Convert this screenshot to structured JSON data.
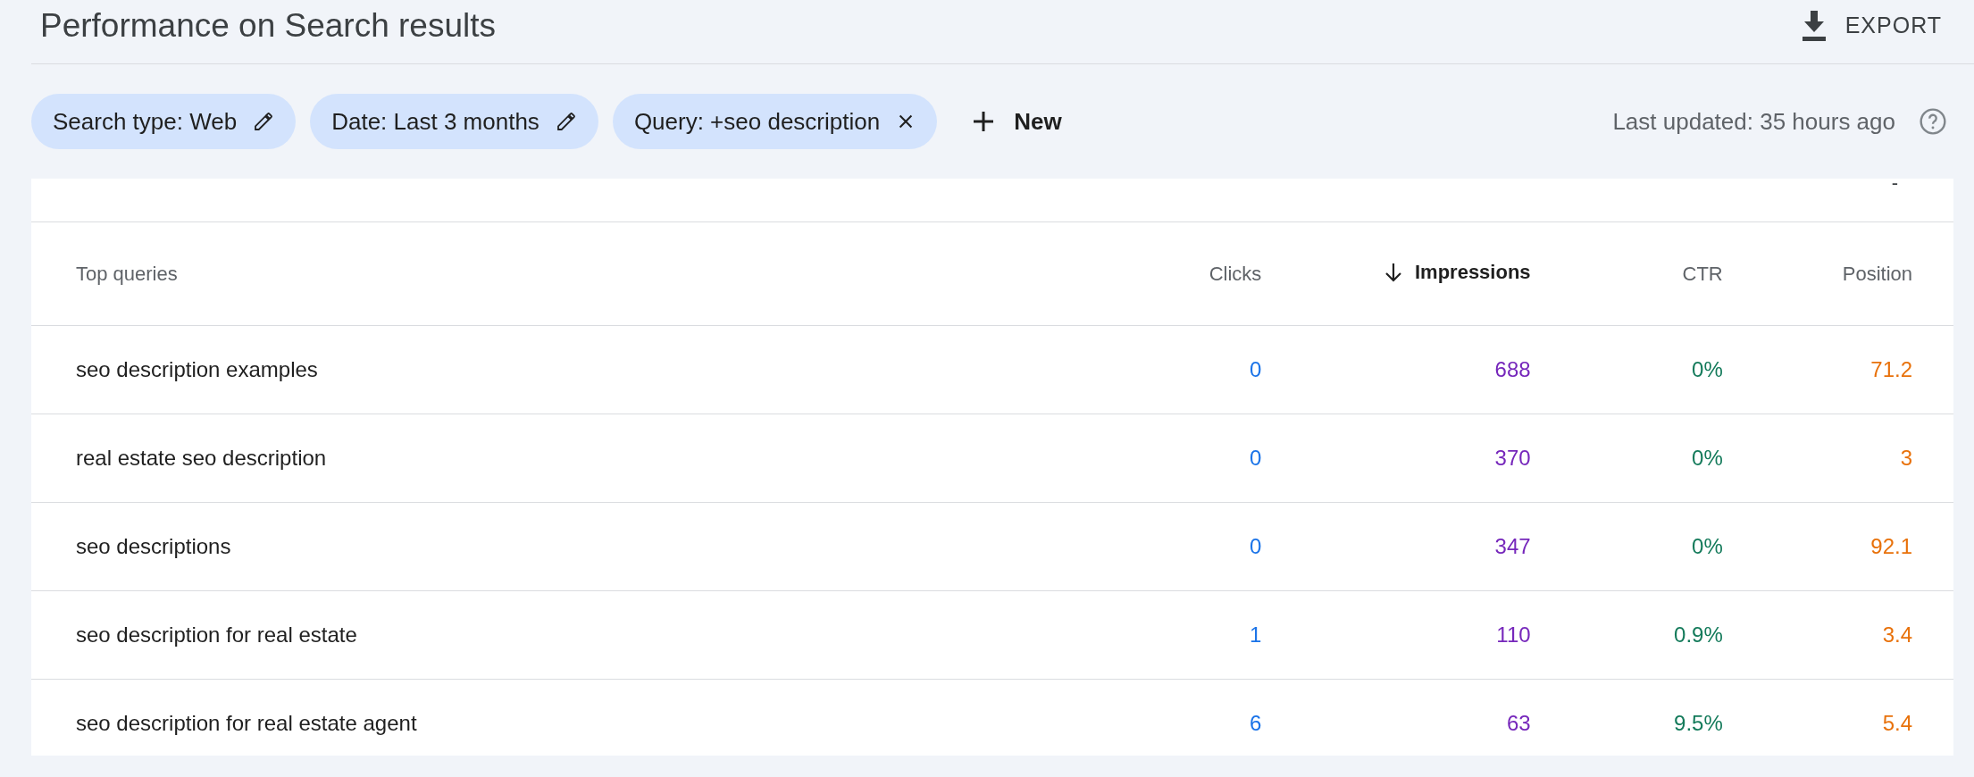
{
  "header": {
    "title": "Performance on Search results",
    "export_label": "EXPORT"
  },
  "filters": {
    "chips": [
      {
        "label": "Search type: Web",
        "kind": "edit"
      },
      {
        "label": "Date: Last 3 months",
        "kind": "edit"
      },
      {
        "label": "Query: +seo description",
        "kind": "remove"
      }
    ],
    "new_label": "New",
    "last_updated": "Last updated: 35 hours ago"
  },
  "card_top": {
    "mark": "-"
  },
  "table": {
    "columns": [
      {
        "label": "Top queries",
        "sorted": false
      },
      {
        "label": "Clicks",
        "sorted": false,
        "color": "#1a73e8"
      },
      {
        "label": "Impressions",
        "sorted": true,
        "color": "#7627bb"
      },
      {
        "label": "CTR",
        "sorted": false,
        "color": "#137a5a"
      },
      {
        "label": "Position",
        "sorted": false,
        "color": "#e8710a"
      }
    ],
    "rows": [
      [
        "seo description examples",
        "0",
        "688",
        "0%",
        "71.2"
      ],
      [
        "real estate seo description",
        "0",
        "370",
        "0%",
        "3"
      ],
      [
        "seo descriptions",
        "0",
        "347",
        "0%",
        "92.1"
      ],
      [
        "seo description for real estate",
        "1",
        "110",
        "0.9%",
        "3.4"
      ],
      [
        "seo description for real estate agent",
        "6",
        "63",
        "9.5%",
        "5.4"
      ]
    ]
  }
}
